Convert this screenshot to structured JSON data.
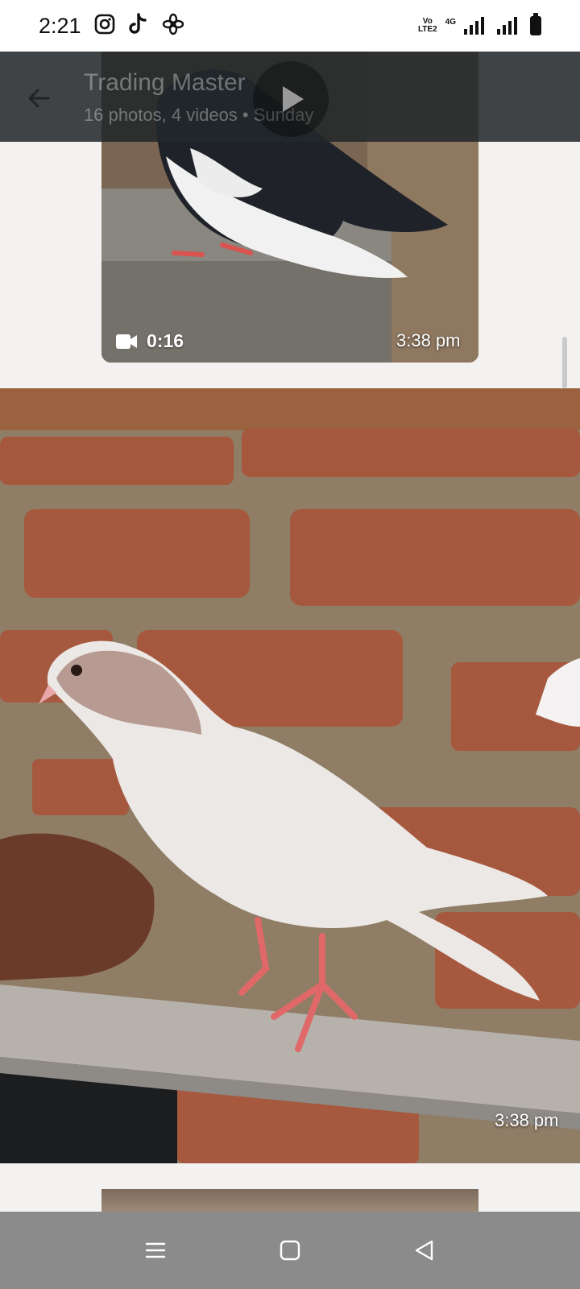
{
  "status_bar": {
    "time": "2:21",
    "app_icons": [
      "instagram-icon",
      "tiktok-icon",
      "pinwheel-icon"
    ],
    "volte_label_line1": "Vo",
    "volte_label_line2": "LTE2",
    "network_label": "4G",
    "battery": "battery-icon"
  },
  "toolbar": {
    "title": "Trading Master",
    "subtitle": "16 photos, 4 videos  •  Sunday"
  },
  "video_item": {
    "duration": "0:16",
    "timestamp": "3:38 pm"
  },
  "photo_item": {
    "timestamp": "3:38 pm"
  },
  "nav_bar": {
    "icons": [
      "recent-apps-icon",
      "home-icon",
      "back-triangle-icon"
    ]
  },
  "colors": {
    "toolbar_bg": "#21262a",
    "nav_bg": "#8b8b8b",
    "status_bg": "#ffffff"
  }
}
